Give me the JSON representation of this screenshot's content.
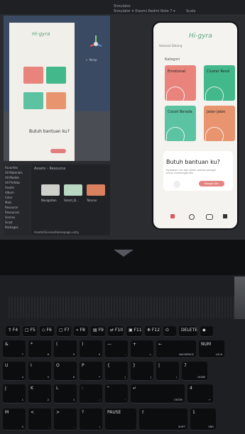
{
  "editor": {
    "toolbar": {
      "simulator": "Simulator",
      "device": "Simulator ▾  Xiaomi Redmi Note 7 ▾",
      "scale": "Scale"
    },
    "scene_gizmo_label": "← Persp",
    "mini_app": {
      "logo": "Hi-gyra",
      "help": "Butuh bantuan ku?"
    },
    "hierarchy": [
      "Favorites",
      "All Materials",
      "All Models",
      "All Prefabs",
      "",
      "Assets",
      "Album",
      "Color",
      "Main",
      "Resource",
      "Resources",
      "Scenes",
      "Scrpt",
      "Packages"
    ],
    "project": {
      "path": "Assets › Resource",
      "assets": [
        "Navigation",
        "Smart_B...",
        "Tolaran"
      ],
      "footer": "Assets/Scenes/Homepage.unity"
    }
  },
  "app": {
    "logo": "Hi-gyra",
    "greeting": "Selamat Datang",
    "category_title": "Kategori",
    "cards": [
      {
        "label": "Emotional",
        "color": "#e9847d"
      },
      {
        "label": "Cluster Rend",
        "color": "#43b88a"
      },
      {
        "label": "Cocok Berada",
        "color": "#5cc3a2"
      },
      {
        "label": "Jalan-Jalan",
        "color": "#e8956f"
      }
    ],
    "help": {
      "title": "Butuh bantuan ku?",
      "subtitle": "Nyalakan mic dan tekan tombol panggil untuk memanggil aku",
      "button": "Panggil Aku"
    },
    "nav_icons": [
      "home-icon",
      "refresh-icon",
      "gamepad-icon",
      "video-icon"
    ]
  },
  "keyboard": {
    "row_fn": [
      {
        "main": "⇑ F4",
        "sub": ""
      },
      {
        "main": "□ F5",
        "sub": ""
      },
      {
        "main": "◇ F6",
        "sub": ""
      },
      {
        "main": "▢ F7",
        "sub": ""
      },
      {
        "main": "» F8",
        "sub": ""
      },
      {
        "main": "▤ F9",
        "sub": ""
      },
      {
        "main": "⇄ F10",
        "sub": ""
      },
      {
        "main": "▣ F11",
        "sub": ""
      },
      {
        "main": "❉ F12",
        "sub": ""
      },
      {
        "main": "⏻",
        "sub": ""
      },
      {
        "main": "DELETE",
        "sub": ""
      },
      {
        "main": "◆",
        "sub": ""
      }
    ],
    "row_num": [
      {
        "main": "&",
        "sub": "7"
      },
      {
        "main": "*",
        "sub": "8"
      },
      {
        "main": "(",
        "sub": "9"
      },
      {
        "main": ")",
        "sub": "0"
      },
      {
        "main": "—",
        "sub": "-"
      },
      {
        "main": "+",
        "sub": "="
      },
      {
        "main": "←",
        "sub": "BACKSPACE"
      },
      {
        "main": "NUM",
        "sub": "LOCK"
      }
    ],
    "row_top": [
      {
        "main": "U",
        "sub": "4"
      },
      {
        "main": "I",
        "sub": "5"
      },
      {
        "main": "O",
        "sub": "6"
      },
      {
        "main": "P",
        "sub": "*"
      },
      {
        "main": "{",
        "sub": "["
      },
      {
        "main": "}",
        "sub": "]"
      },
      {
        "main": "|",
        "sub": "\\"
      },
      {
        "main": "7",
        "sub": "HOME"
      }
    ],
    "row_home": [
      {
        "main": "J",
        "sub": "1"
      },
      {
        "main": "K",
        "sub": "2"
      },
      {
        "main": "L",
        "sub": "3"
      },
      {
        "main": ":",
        "sub": ";"
      },
      {
        "main": "\"",
        "sub": "'"
      },
      {
        "main": "↵",
        "sub": "ENTER"
      },
      {
        "main": "4",
        "sub": "←"
      }
    ],
    "row_bottom": [
      {
        "main": "M",
        "sub": "0"
      },
      {
        "main": "<",
        "sub": ","
      },
      {
        "main": ">",
        "sub": "."
      },
      {
        "main": "?",
        "sub": "/"
      },
      {
        "main": "PAUSE",
        "sub": ""
      },
      {
        "main": "⇧",
        "sub": "SHIFT"
      },
      {
        "main": "1",
        "sub": "END"
      }
    ]
  }
}
